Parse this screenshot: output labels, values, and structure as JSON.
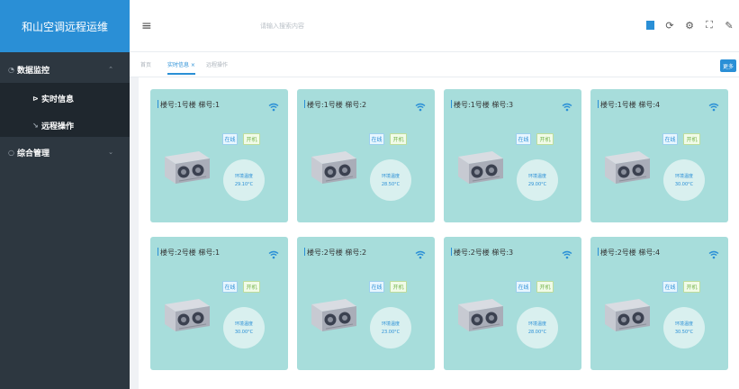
{
  "app": {
    "title": "和山空调远程运维"
  },
  "sidebar": {
    "items": [
      {
        "label": "数据监控",
        "icon": "dashboard-icon",
        "expanded": true
      },
      {
        "label": "实时信息",
        "icon": "play-icon",
        "active": true
      },
      {
        "label": "远程操作",
        "icon": "wrench-icon"
      },
      {
        "label": "综合管理",
        "icon": "dot-icon"
      }
    ]
  },
  "header": {
    "search_placeholder": "请输入搜索内容",
    "toolbar_icons": [
      "color-square-icon",
      "refresh-icon",
      "settings-icon",
      "fullscreen-icon",
      "pen-icon"
    ]
  },
  "tabs": [
    {
      "label": "首页"
    },
    {
      "label": "实时信息 ×",
      "active": true
    },
    {
      "label": "远程操作"
    }
  ],
  "more_label": "更多",
  "cards": [
    {
      "title": "楼号:1号楼 梯号:1",
      "status": "在线",
      "power": "开机",
      "temp_label": "环境温度",
      "temp": "29.10°C"
    },
    {
      "title": "楼号:1号楼 梯号:2",
      "status": "在线",
      "power": "开机",
      "temp_label": "环境温度",
      "temp": "28.50°C"
    },
    {
      "title": "楼号:1号楼 梯号:3",
      "status": "在线",
      "power": "开机",
      "temp_label": "环境温度",
      "temp": "29.00°C"
    },
    {
      "title": "楼号:1号楼 梯号:4",
      "status": "在线",
      "power": "开机",
      "temp_label": "环境温度",
      "temp": "30.00°C"
    },
    {
      "title": "楼号:2号楼 梯号:1",
      "status": "在线",
      "power": "开机",
      "temp_label": "环境温度",
      "temp": "30.00°C"
    },
    {
      "title": "楼号:2号楼 梯号:2",
      "status": "在线",
      "power": "开机",
      "temp_label": "环境温度",
      "temp": "23.00°C"
    },
    {
      "title": "楼号:2号楼 梯号:3",
      "status": "在线",
      "power": "开机",
      "temp_label": "环境温度",
      "temp": "28.00°C"
    },
    {
      "title": "楼号:2号楼 梯号:4",
      "status": "在线",
      "power": "开机",
      "temp_label": "环境温度",
      "temp": "30.50°C"
    }
  ],
  "colors": {
    "accent": "#2a8fd6",
    "sidebar": "#2d3740",
    "card": "#a7dddb"
  }
}
